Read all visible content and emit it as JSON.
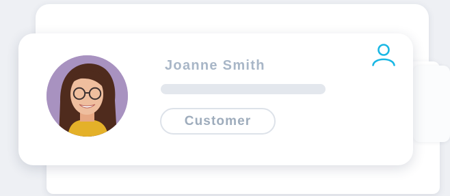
{
  "profile": {
    "name": "Joanne Smith",
    "role": "Customer",
    "avatar_description": "portrait photo of a smiling woman with glasses",
    "icon": "user-icon"
  },
  "colors": {
    "accent": "#19b7e4",
    "name_text": "#a8b6c7",
    "badge_border": "#dde2e9",
    "bar": "#e3e7ed",
    "background": "#eef0f4",
    "avatar_background": "#a892c0"
  }
}
